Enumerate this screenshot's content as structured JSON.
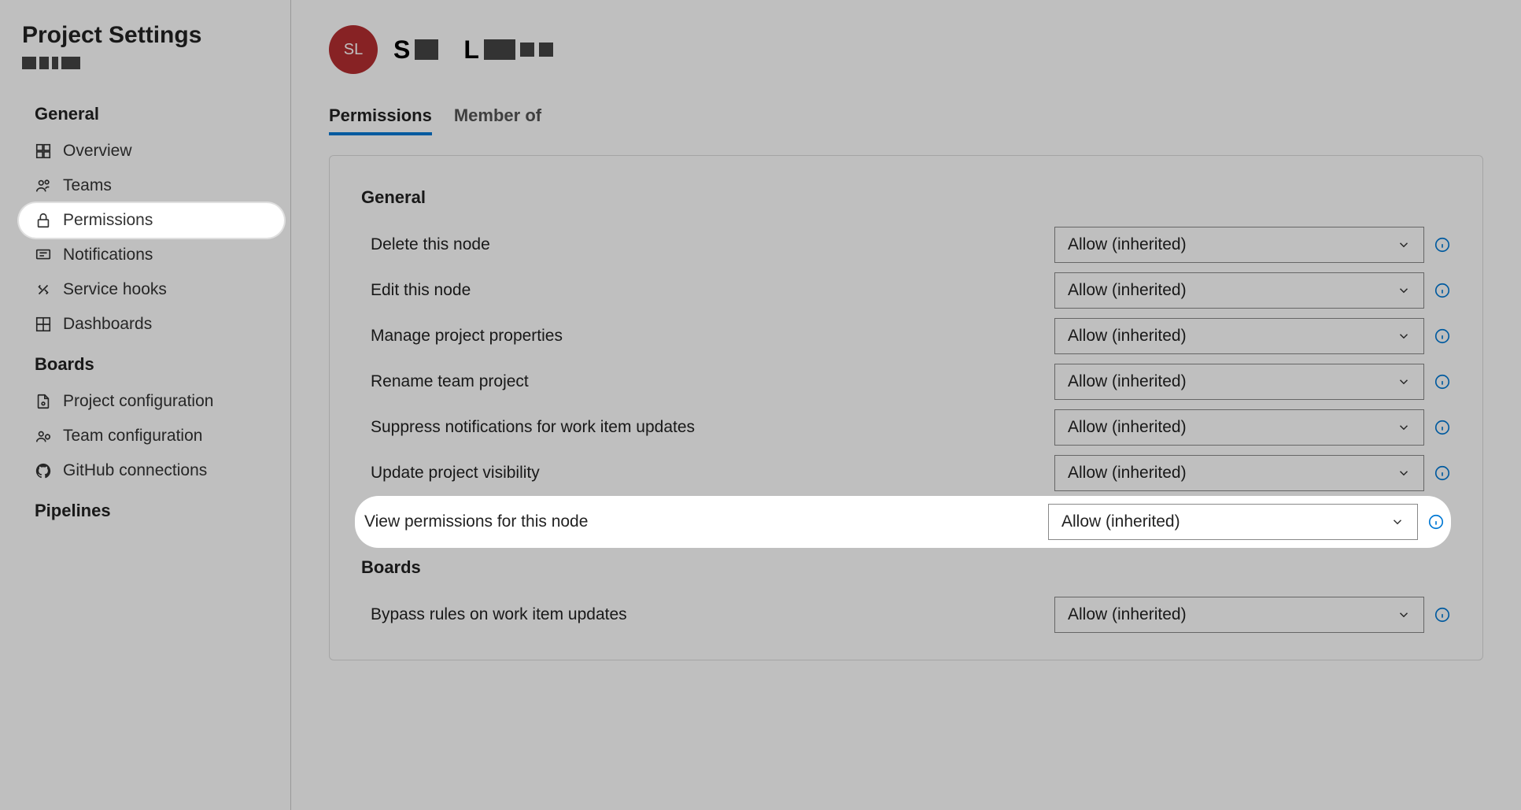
{
  "sidebar": {
    "title": "Project Settings",
    "sections": [
      {
        "header": "General",
        "items": [
          {
            "icon": "overview",
            "label": "Overview"
          },
          {
            "icon": "teams",
            "label": "Teams"
          },
          {
            "icon": "lock",
            "label": "Permissions",
            "selected": true,
            "highlighted": true
          },
          {
            "icon": "notifications",
            "label": "Notifications"
          },
          {
            "icon": "servicehooks",
            "label": "Service hooks"
          },
          {
            "icon": "dashboards",
            "label": "Dashboards"
          }
        ]
      },
      {
        "header": "Boards",
        "items": [
          {
            "icon": "projectconfig",
            "label": "Project configuration"
          },
          {
            "icon": "teamconfig",
            "label": "Team configuration"
          },
          {
            "icon": "github",
            "label": "GitHub connections"
          }
        ]
      },
      {
        "header": "Pipelines",
        "items": []
      }
    ]
  },
  "main": {
    "avatar_initials": "SL",
    "user_name_prefix": "S",
    "user_name_mid": "L",
    "tabs": [
      {
        "label": "Permissions",
        "active": true
      },
      {
        "label": "Member of",
        "active": false
      }
    ],
    "perm_sections": [
      {
        "header": "General",
        "rows": [
          {
            "label": "Delete this node",
            "value": "Allow (inherited)"
          },
          {
            "label": "Edit this node",
            "value": "Allow (inherited)"
          },
          {
            "label": "Manage project properties",
            "value": "Allow (inherited)"
          },
          {
            "label": "Rename team project",
            "value": "Allow (inherited)"
          },
          {
            "label": "Suppress notifications for work item updates",
            "value": "Allow (inherited)"
          },
          {
            "label": "Update project visibility",
            "value": "Allow (inherited)"
          },
          {
            "label": "View permissions for this node",
            "value": "Allow (inherited)",
            "highlighted": true
          }
        ]
      },
      {
        "header": "Boards",
        "rows": [
          {
            "label": "Bypass rules on work item updates",
            "value": "Allow (inherited)"
          }
        ]
      }
    ]
  }
}
